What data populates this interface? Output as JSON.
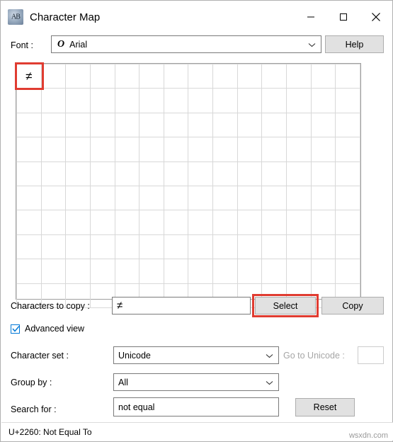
{
  "window": {
    "title": "Character Map",
    "app_icon": "character-map-icon",
    "controls": {
      "minimize": "minimize-icon",
      "maximize": "maximize-icon",
      "close": "close-icon"
    }
  },
  "font_row": {
    "label": "Font :",
    "value": "Arial",
    "sample_glyph": "O",
    "help_button": "Help"
  },
  "grid": {
    "columns": 14,
    "rows": 10,
    "selected_char": "≠",
    "characters": [
      "≠"
    ]
  },
  "copy_row": {
    "label": "Characters to copy :",
    "value": "≠",
    "select_button": "Select",
    "copy_button": "Copy"
  },
  "advanced": {
    "label": "Advanced view",
    "checked": true
  },
  "character_set": {
    "label": "Character set :",
    "value": "Unicode"
  },
  "goto_unicode": {
    "label": "Go to Unicode :",
    "value": "",
    "enabled": false
  },
  "group_by": {
    "label": "Group by :",
    "value": "All"
  },
  "search": {
    "label": "Search for :",
    "value": "not equal",
    "reset_button": "Reset"
  },
  "status_bar": {
    "text": "U+2260: Not Equal To"
  },
  "watermark": "wsxdn.com",
  "colors": {
    "highlight": "#e03c31",
    "checkbox_accent": "#0078d7",
    "disabled_text": "#a6a6a6"
  }
}
